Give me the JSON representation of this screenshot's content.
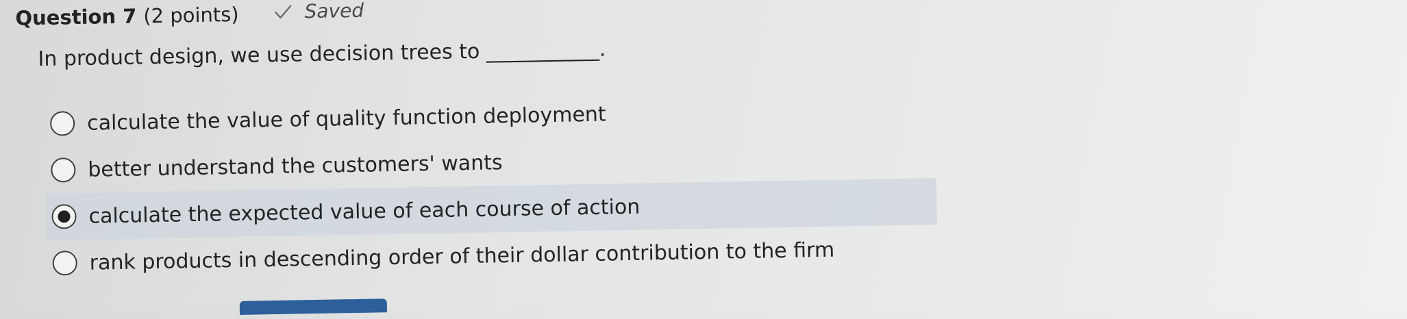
{
  "question": {
    "title": "Question 7",
    "points": "(2 points)",
    "status": "Saved",
    "status_icon": "check-icon",
    "prompt": "In product design, we use decision trees to ___________."
  },
  "answers": [
    {
      "label": "calculate the value of quality function deployment",
      "selected": false
    },
    {
      "label": "better understand the customers' wants",
      "selected": false
    },
    {
      "label": "calculate the expected value of each course of action",
      "selected": true
    },
    {
      "label": "rank products in descending order of their dollar contribution to the firm",
      "selected": false
    }
  ],
  "colors": {
    "selected_row": "#cdd6de",
    "button": "#2d5f9a",
    "text": "#232323"
  }
}
